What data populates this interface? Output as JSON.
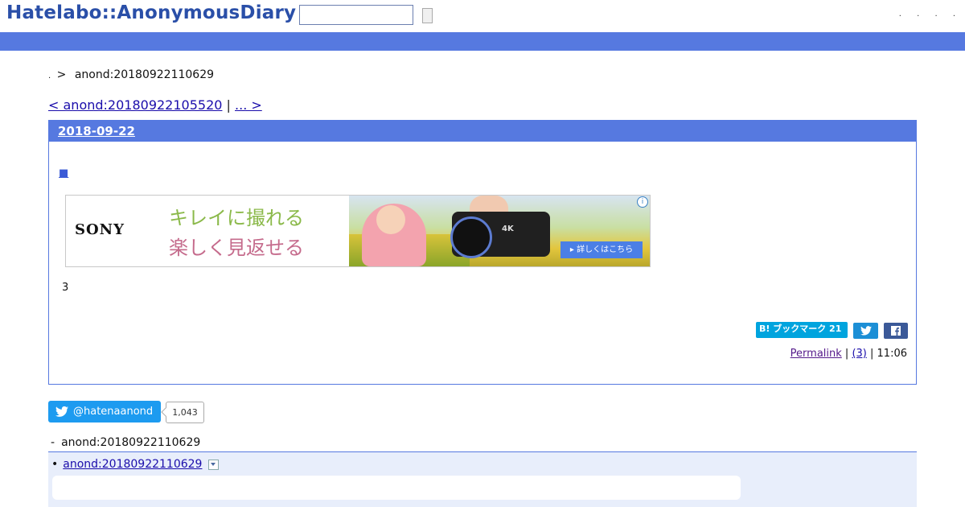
{
  "header": {
    "logo": "Hatelabo::AnonymousDiary",
    "search_placeholder": "",
    "header_links": [
      ".",
      ".",
      ".",
      "."
    ]
  },
  "breadcrumb": {
    "dot": ".",
    "separator": ">",
    "current": "anond:20180922110629"
  },
  "pager": {
    "prev": "< anond:20180922105520",
    "divider": "|",
    "next": "... > "
  },
  "entry": {
    "date": "2018-09-22",
    "square_link": "■",
    "text": "3",
    "share": {
      "bookmark_label": "B! ブックマーク 21",
      "twitter_icon": "twitter-bird-icon",
      "facebook_icon": "facebook-f-icon"
    },
    "footer": {
      "permalink": "Permalink",
      "sep1": " | ",
      "comments": "(3)",
      "sep2": " | ",
      "time": "11:06"
    }
  },
  "ad": {
    "brand": "SONY",
    "line1": "キレイに撮れる",
    "line2": "楽しく見返せる",
    "cta": "▸ 詳しくはこちら",
    "info": "i",
    "camera_label": "4K"
  },
  "follow": {
    "handle": "@hatenaanond",
    "count": "1,043"
  },
  "related": {
    "dash": "-",
    "label": "anond:20180922110629",
    "bullet": "•",
    "item": "anond:20180922110629"
  },
  "colors": {
    "brand_blue": "#5679e0",
    "logo_blue": "#2a4fa8",
    "twitter": "#1d9bf0",
    "facebook": "#3b5998",
    "hatena": "#00a4de"
  }
}
